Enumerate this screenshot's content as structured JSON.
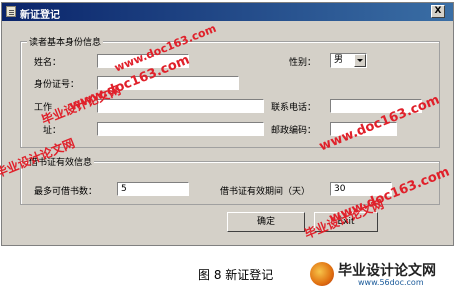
{
  "window": {
    "title": "新证登记",
    "close_label": "X"
  },
  "basic_group": {
    "legend": "读者基本身份信息",
    "name_label": "姓名：",
    "name_value": "",
    "gender_label": "性别：",
    "gender_value": "男",
    "id_label": "身份证号：",
    "id_value": "",
    "work_label": "工作",
    "work_value": "",
    "phone_label": "联系电话：",
    "phone_value": "",
    "address_label": "址：",
    "address_value": "",
    "postcode_label": "邮政编码：",
    "postcode_value": ""
  },
  "card_group": {
    "legend": "借书证有效信息",
    "max_label": "最多可借书数：",
    "max_value": "5",
    "period_label": "借书证有效期间（天）",
    "period_value": "30"
  },
  "buttons": {
    "ok": "确定",
    "exit": "Exit"
  },
  "caption": "图 8 新证登记",
  "watermarks": {
    "text_cn": "毕业设计论文网",
    "text_url": "www.doc163.com"
  },
  "logo": {
    "text": "毕业设计论文网",
    "url": "www.56doc.com"
  },
  "colors": {
    "titlebar_start": "#0a246a",
    "titlebar_end": "#3a6ea5",
    "watermark": "#e0202a",
    "dialog_bg": "#d4d0c8"
  }
}
